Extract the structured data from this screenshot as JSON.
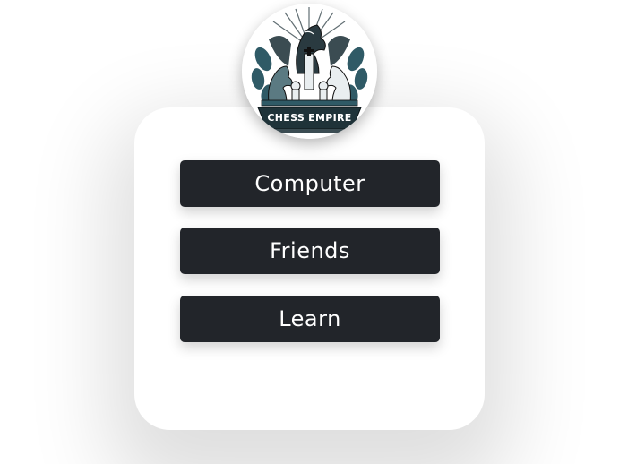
{
  "logo": {
    "text": "CHESS EMPIRE",
    "icon": "chess-knight-crest-icon"
  },
  "menu": {
    "computer_label": "Computer",
    "friends_label": "Friends",
    "learn_label": "Learn"
  },
  "colors": {
    "button_bg": "#22252a",
    "button_text": "#ffffff",
    "logo_accent": "#2f5a66"
  }
}
